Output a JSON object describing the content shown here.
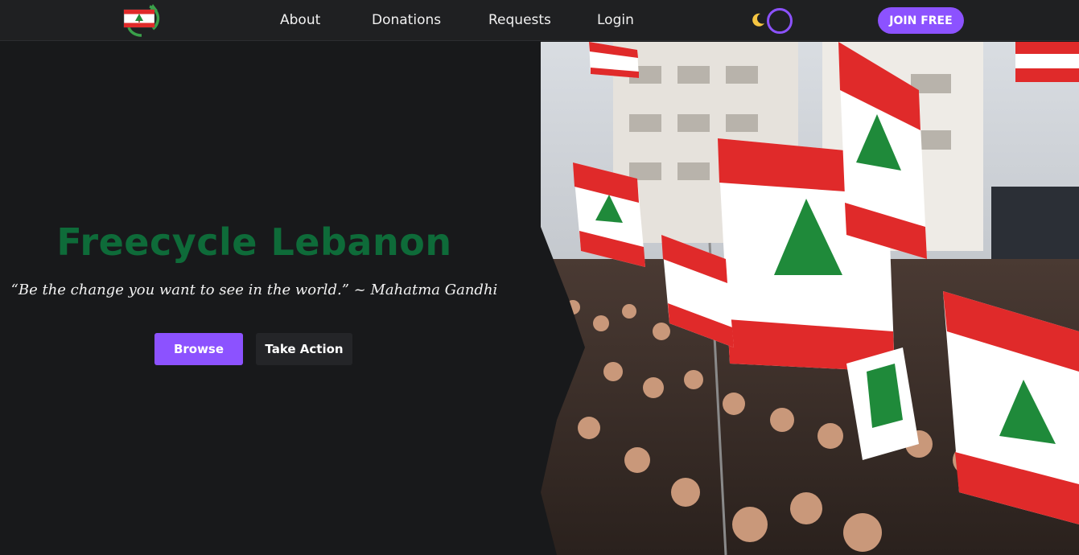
{
  "nav": {
    "logo_icon": "lebanon-flag-recycle-logo",
    "links": [
      "About",
      "Donations",
      "Requests",
      "Login"
    ],
    "theme_icon": "moon-icon",
    "join_label": "JOIN FREE"
  },
  "hero": {
    "title": "Freecycle Lebanon",
    "quote": "“Be the change you want to see in the world.” ~ Mahatma Gandhi",
    "browse_label": "Browse",
    "action_label": "Take Action",
    "image_icon": "crowd-with-lebanese-flags-photo"
  },
  "colors": {
    "accent": "#8c52ff",
    "title_green": "#0e6b39",
    "background": "#18191b",
    "navbar": "#1f2022",
    "flag_red": "#e02a2a",
    "cedar_green": "#1f8a3a"
  }
}
